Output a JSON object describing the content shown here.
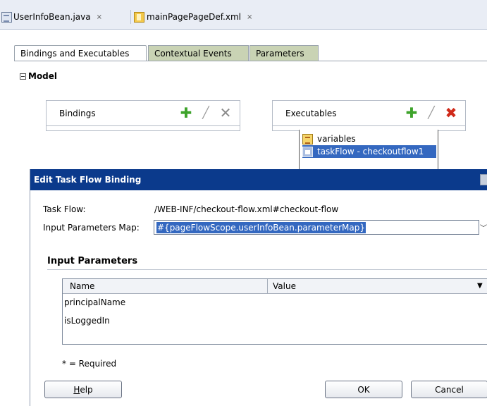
{
  "editor_tabs": [
    {
      "label": "UserInfoBean.java",
      "close": "×"
    },
    {
      "label": "mainPagePageDef.xml",
      "close": "×"
    }
  ],
  "binding_tabs": [
    {
      "label": "Bindings and Executables"
    },
    {
      "label": "Contextual Events"
    },
    {
      "label": "Parameters"
    }
  ],
  "model": {
    "title": "Model"
  },
  "bindings_panel": {
    "title": "Bindings"
  },
  "executables_panel": {
    "title": "Executables",
    "items": [
      {
        "label": "variables",
        "icon": "variables-icon"
      },
      {
        "label": "taskFlow - checkoutflow1",
        "icon": "taskflow-icon",
        "selected": true
      }
    ]
  },
  "dialog": {
    "title": "Edit Task Flow Binding",
    "task_flow_label": "Task Flow:",
    "task_flow_value": "/WEB-INF/checkout-flow.xml#checkout-flow",
    "input_params_map_label": "Input Parameters Map:",
    "input_params_map_value": "#{pageFlowScope.userInfoBean.parameterMap}",
    "section_title": "Input Parameters",
    "table": {
      "headers": [
        "Name",
        "Value"
      ],
      "rows": [
        {
          "name": "principalName",
          "value": ""
        },
        {
          "name": "isLoggedIn",
          "value": ""
        }
      ]
    },
    "required_note": "* = Required",
    "buttons": {
      "help_prefix": "",
      "help_mnemonic": "H",
      "help_rest": "elp",
      "ok": "OK",
      "cancel": "Cancel"
    }
  },
  "colors": {
    "title_bar": "#0b3a8c",
    "selection": "#3468c0",
    "add": "#3ea32b",
    "delete": "#d02a1a"
  }
}
